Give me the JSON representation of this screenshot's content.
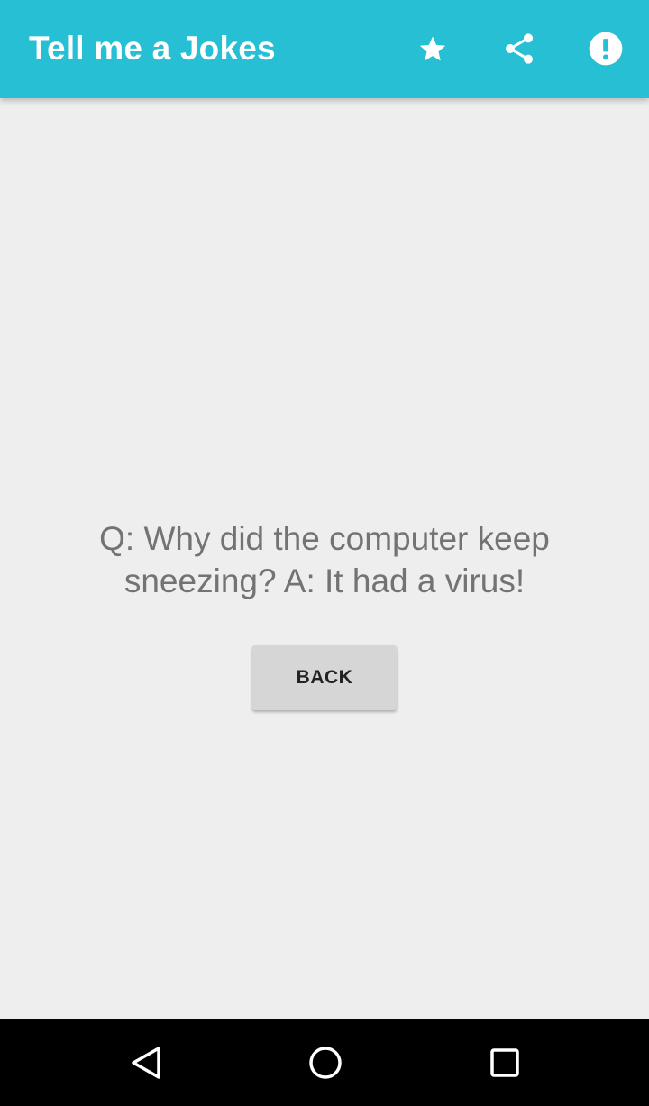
{
  "app_bar": {
    "title": "Tell me a Jokes",
    "background_color": "#26bfd3",
    "actions": [
      {
        "icon": "star-icon",
        "label": "favorite"
      },
      {
        "icon": "share-icon",
        "label": "share"
      },
      {
        "icon": "report-icon",
        "label": "report"
      }
    ]
  },
  "joke": {
    "text": "Q: Why did the computer keep sneezing? A: It had a virus!",
    "text_color": "#737373"
  },
  "back_button": {
    "label": "BACK",
    "background_color": "#d6d6d6"
  },
  "nav_bar": {
    "items": [
      {
        "icon": "nav-back-icon"
      },
      {
        "icon": "nav-home-icon"
      },
      {
        "icon": "nav-recents-icon"
      }
    ]
  },
  "colors": {
    "screen_background": "#eeeeee",
    "nav_background": "#000000"
  }
}
